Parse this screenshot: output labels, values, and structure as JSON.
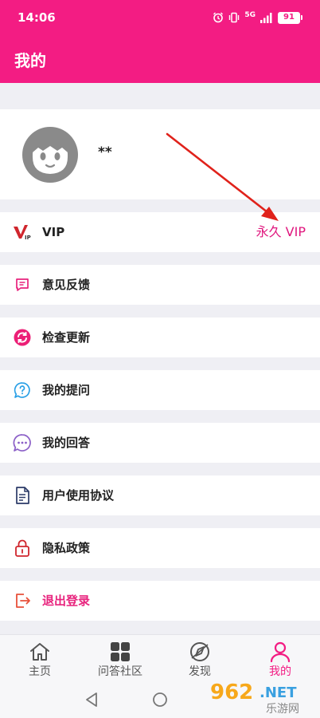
{
  "status_bar": {
    "time": "14:06",
    "network": "5G",
    "battery": "91"
  },
  "header": {
    "title": "我的"
  },
  "profile": {
    "username": "**"
  },
  "menu": [
    {
      "id": "vip",
      "label": "VIP",
      "value": "永久 VIP",
      "icon": "vip-icon"
    },
    {
      "id": "feedback",
      "label": "意见反馈",
      "icon": "feedback-icon"
    },
    {
      "id": "update",
      "label": "检查更新",
      "icon": "update-icon"
    },
    {
      "id": "my-questions",
      "label": "我的提问",
      "icon": "question-icon"
    },
    {
      "id": "my-answers",
      "label": "我的回答",
      "icon": "answer-icon"
    },
    {
      "id": "user-agreement",
      "label": "用户使用协议",
      "icon": "document-icon"
    },
    {
      "id": "privacy",
      "label": "隐私政策",
      "icon": "lock-icon"
    },
    {
      "id": "logout",
      "label": "退出登录",
      "icon": "logout-icon"
    }
  ],
  "tabs": [
    {
      "label": "主页",
      "icon": "home-icon",
      "active": false
    },
    {
      "label": "问答社区",
      "icon": "grid-icon",
      "active": false
    },
    {
      "label": "发现",
      "icon": "compass-icon",
      "active": false
    },
    {
      "label": "我的",
      "icon": "person-icon",
      "active": true
    }
  ],
  "watermark": {
    "number": "962",
    "suffix": ".NET",
    "caption": "乐游网"
  },
  "colors": {
    "brand": "#f31c83",
    "accent_text": "#e0177e",
    "background": "#efeff4",
    "arrow": "#e0221b"
  }
}
